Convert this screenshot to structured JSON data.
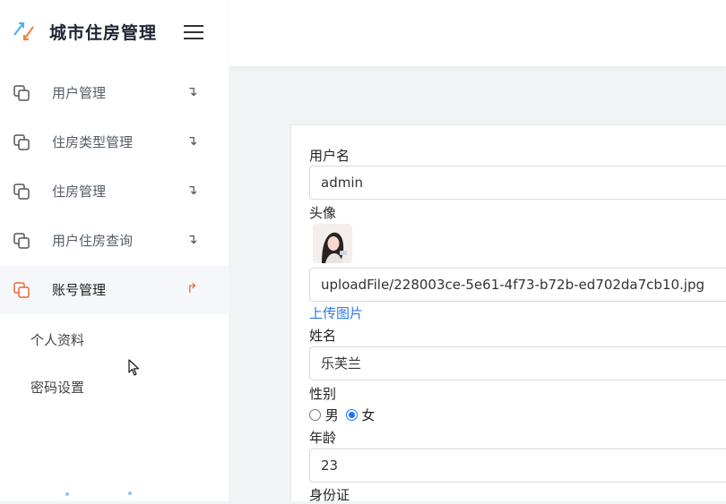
{
  "app": {
    "title": "城市住房管理"
  },
  "sidebar": {
    "items": [
      {
        "label": "用户管理",
        "arrow": "↴"
      },
      {
        "label": "住房类型管理",
        "arrow": "↴"
      },
      {
        "label": "住房管理",
        "arrow": "↴"
      },
      {
        "label": "用户住房查询",
        "arrow": "↴"
      },
      {
        "label": "账号管理",
        "arrow": "↱"
      }
    ],
    "sub_items": [
      {
        "label": "个人资料"
      },
      {
        "label": "密码设置"
      }
    ]
  },
  "form": {
    "username_label": "用户名",
    "username_value": "admin",
    "avatar_label": "头像",
    "avatar_path": "uploadFile/228003ce-5e61-4f73-b72b-ed702da7cb10.jpg",
    "upload_link": "上传图片",
    "name_label": "姓名",
    "name_value": "乐芙兰",
    "gender_label": "性别",
    "gender_options": [
      "男",
      "女"
    ],
    "gender_selected": "女",
    "age_label": "年龄",
    "age_value": "23",
    "id_label": "身份证"
  },
  "colors": {
    "accent": "#e8673a",
    "link": "#2d7be0",
    "radio": "#1677ff"
  }
}
